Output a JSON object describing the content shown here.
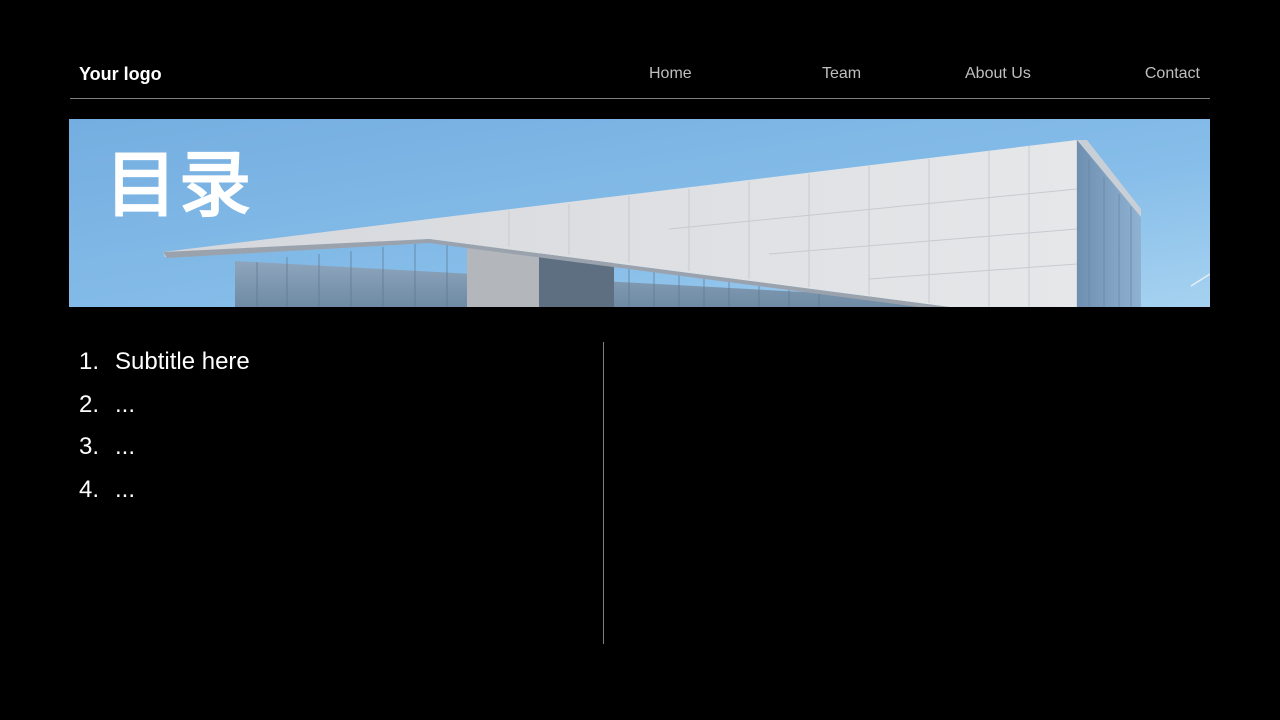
{
  "header": {
    "logo": "Your logo",
    "nav": [
      {
        "label": "Home"
      },
      {
        "label": "Team"
      },
      {
        "label": "About Us"
      },
      {
        "label": "Contact"
      }
    ]
  },
  "banner": {
    "title": "目录",
    "sky_color": "#7fb5e3"
  },
  "toc": {
    "items": [
      {
        "number": "1.",
        "label": "Subtitle here"
      },
      {
        "number": "2.",
        "label": "..."
      },
      {
        "number": "3.",
        "label": "..."
      },
      {
        "number": "4.",
        "label": "..."
      }
    ]
  },
  "colors": {
    "background": "#000000",
    "text": "#ffffff",
    "nav_text": "#bfbfbf",
    "rule": "#7f7f7f"
  }
}
